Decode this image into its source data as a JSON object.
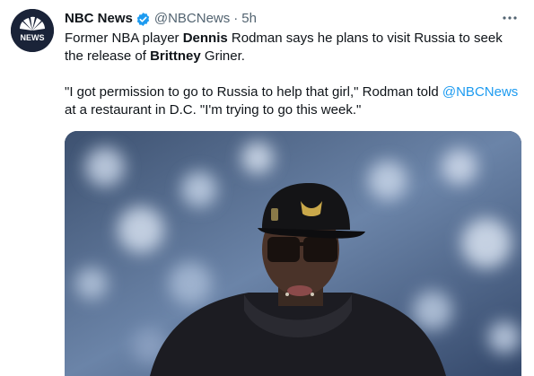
{
  "tweet": {
    "avatar_text": "NEWS",
    "display_name": "NBC News",
    "handle": "@NBCNews",
    "separator": "·",
    "time": "5h",
    "more_icon": "more-horizontal-icon",
    "verified_icon": "verified-badge-icon",
    "line1": {
      "t1": "Former NBA player ",
      "b1": "Dennis",
      "t2": " Rodman says he plans to visit Russia to seek"
    },
    "line2": {
      "t1": "the release of ",
      "b1": "Brittney",
      "t2": " Griner."
    },
    "line3": {
      "t1": "\"I got permission to go to Russia to help that girl,\" Rodman told ",
      "mention": "@NBCNews"
    },
    "line4": {
      "t1": "at a restaurant in D.C. \"I'm trying to go this week.\""
    }
  },
  "colors": {
    "text": "#0f1419",
    "secondary": "#536471",
    "link": "#1d9bf0",
    "avatar_bg": "#1a2338"
  }
}
